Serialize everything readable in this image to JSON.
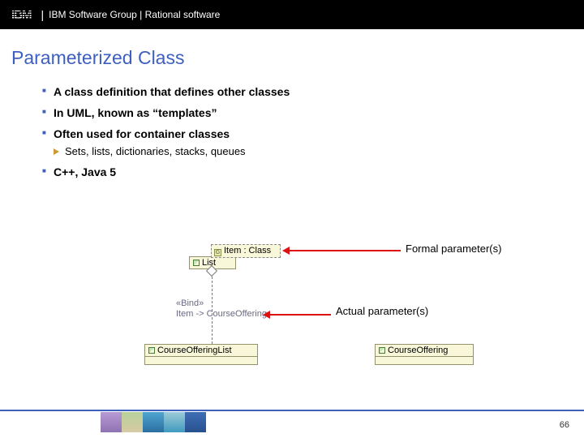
{
  "header": {
    "logo_text": "IBM",
    "text": "IBM Software Group | Rational software"
  },
  "title": "Parameterized Class",
  "bullets": [
    {
      "text": "A class definition that defines other classes"
    },
    {
      "text": "In UML, known as “templates”"
    },
    {
      "text": "Often used for container classes",
      "sub": [
        "Sets, lists, dictionaries, stacks, queues"
      ]
    },
    {
      "text": "C++, Java 5"
    }
  ],
  "diagram": {
    "template_param": "Item : Class",
    "template_class": "List",
    "binding_stereotype": "«Bind»",
    "binding_text": "Item -> CourseOffering",
    "bound_class_left": "CourseOfferingList",
    "bound_class_right": "CourseOffering",
    "label_formal": "Formal parameter(s)",
    "label_actual": "Actual parameter(s)"
  },
  "page_number": "66"
}
